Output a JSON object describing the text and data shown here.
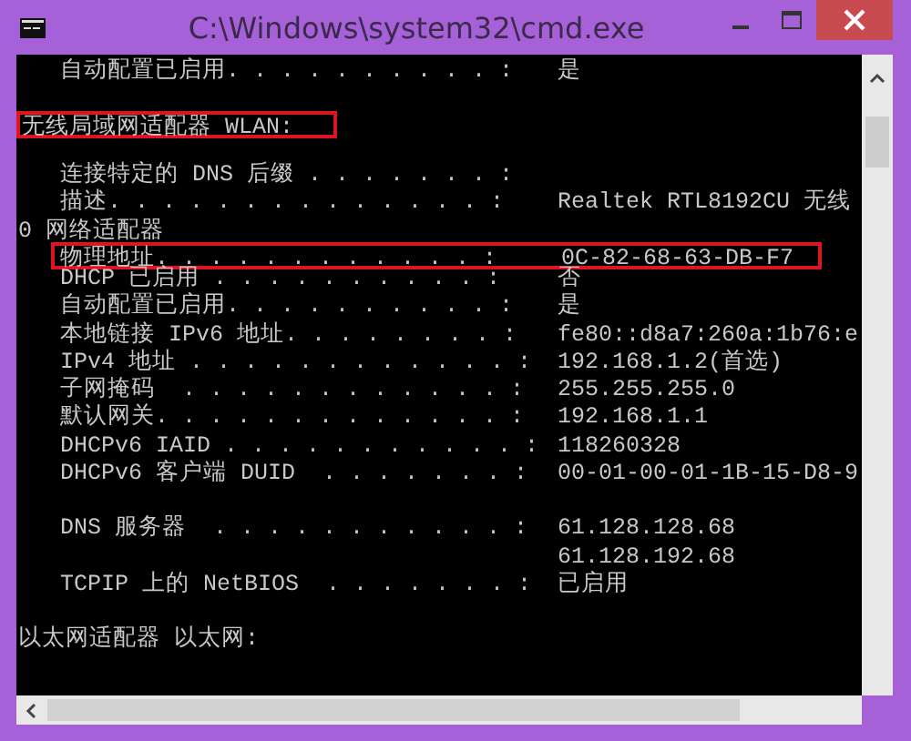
{
  "window": {
    "title": "C:\\Windows\\system32\\cmd.exe"
  },
  "lines": [
    {
      "kind": "entry",
      "label": "自动配置已启用. . . . . . . . . . :",
      "value": "是",
      "highlighted": false
    },
    {
      "kind": "blank"
    },
    {
      "kind": "header",
      "text": "无线局域网适配器 WLAN:",
      "highlighted": true
    },
    {
      "kind": "blank"
    },
    {
      "kind": "entry",
      "label": "连接特定的 DNS 后缀 . . . . . . . :",
      "highlighted": false
    },
    {
      "kind": "entry",
      "label": "描述. . . . . . . . . . . . . . :",
      "value": "Realtek RTL8192CU 无线",
      "highlighted": false
    },
    {
      "kind": "header",
      "text": "0 网络适配器",
      "highlighted": false
    },
    {
      "kind": "entry",
      "label": "物理地址. . . . . . . . . . . . :",
      "value": "0C-82-68-63-DB-F7",
      "highlighted": true
    },
    {
      "kind": "entry",
      "label": "DHCP 已启用 . . . . . . . . . . :",
      "value": "否",
      "highlighted": false
    },
    {
      "kind": "entry",
      "label": "自动配置已启用. . . . . . . . . . :",
      "value": "是",
      "highlighted": false
    },
    {
      "kind": "entry",
      "label": "本地链接 IPv6 地址. . . . . . . . :",
      "value": "fe80::d8a7:260a:1b76:e",
      "highlighted": false
    },
    {
      "kind": "entry",
      "label": "IPv4 地址 . . . . . . . . . . . . :",
      "value": "192.168.1.2(首选)",
      "highlighted": false
    },
    {
      "kind": "entry",
      "label": "子网掩码  . . . . . . . . . . . . :",
      "value": "255.255.255.0",
      "highlighted": false
    },
    {
      "kind": "entry",
      "label": "默认网关. . . . . . . . . . . . . :",
      "value": "192.168.1.1",
      "highlighted": false
    },
    {
      "kind": "entry",
      "label": "DHCPv6 IAID . . . . . . . . . . . :",
      "value": "118260328",
      "highlighted": false
    },
    {
      "kind": "entry",
      "label": "DHCPv6 客户端 DUID  . . . . . . . :",
      "value": "00-01-00-01-1B-15-D8-9",
      "highlighted": false
    },
    {
      "kind": "blank"
    },
    {
      "kind": "entry",
      "label": "DNS 服务器  . . . . . . . . . . . :",
      "value": "61.128.128.68",
      "highlighted": false
    },
    {
      "kind": "more",
      "value": "61.128.192.68",
      "highlighted": false
    },
    {
      "kind": "entry",
      "label": "TCPIP 上的 NetBIOS  . . . . . . . :",
      "value": "已启用",
      "highlighted": false
    },
    {
      "kind": "blank"
    },
    {
      "kind": "header",
      "text": "以太网适配器 以太网:",
      "highlighted": false
    }
  ]
}
